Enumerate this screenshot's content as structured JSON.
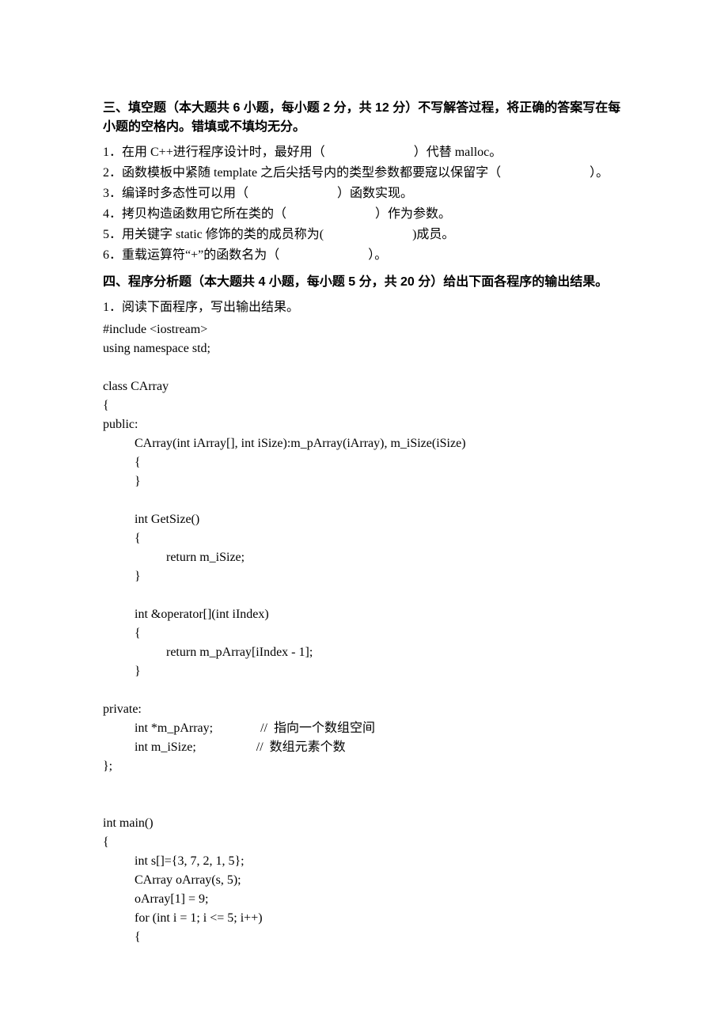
{
  "section3": {
    "title": "三、填空题（本大题共 6 小题，每小题 2 分，共 12 分）不写解答过程，将正确的答案写在每小题的空格内。错填或不填均无分。",
    "items": [
      "1．在用 C++进行程序设计时，最好用（　　　　　　　）代替 malloc。",
      "2．函数模板中紧随 template 之后尖括号内的类型参数都要寇以保留字（　　　　　　　）。",
      "3．编译时多态性可以用（　　　　　　　）函数实现。",
      "4．拷贝构造函数用它所在类的（　　　　　　　）作为参数。",
      "5．用关键字 static 修饰的类的成员称为(　　　　　　　)成员。",
      "6．重载运算符“+”的函数名为（　　　　　　　）。"
    ]
  },
  "section4": {
    "title": "四、程序分析题（本大题共 4 小题，每小题 5 分，共 20 分）给出下面各程序的输出结果。",
    "q1": {
      "prompt": "1．阅读下面程序，写出输出结果。",
      "code": [
        {
          "i": 0,
          "t": "#include <iostream>"
        },
        {
          "i": 0,
          "t": "using namespace std;"
        },
        {
          "i": 0,
          "t": ""
        },
        {
          "i": 0,
          "t": "class CArray"
        },
        {
          "i": 0,
          "t": "{"
        },
        {
          "i": 0,
          "t": "public:"
        },
        {
          "i": 1,
          "t": "CArray(int iArray[], int iSize):m_pArray(iArray), m_iSize(iSize)"
        },
        {
          "i": 1,
          "t": "{"
        },
        {
          "i": 1,
          "t": "}"
        },
        {
          "i": 0,
          "t": ""
        },
        {
          "i": 1,
          "t": "int GetSize()"
        },
        {
          "i": 1,
          "t": "{"
        },
        {
          "i": 2,
          "t": "return m_iSize;"
        },
        {
          "i": 1,
          "t": "}"
        },
        {
          "i": 0,
          "t": ""
        },
        {
          "i": 1,
          "t": "int &operator[](int iIndex)"
        },
        {
          "i": 1,
          "t": "{"
        },
        {
          "i": 2,
          "t": "return m_pArray[iIndex - 1];"
        },
        {
          "i": 1,
          "t": "}"
        },
        {
          "i": 0,
          "t": ""
        },
        {
          "i": 0,
          "t": "private:"
        },
        {
          "i": 1,
          "t": "int *m_pArray;               //  指向一个数组空间"
        },
        {
          "i": 1,
          "t": "int m_iSize;                   //  数组元素个数"
        },
        {
          "i": 0,
          "t": "};"
        },
        {
          "i": 0,
          "t": ""
        },
        {
          "i": 0,
          "t": ""
        },
        {
          "i": 0,
          "t": "int main()"
        },
        {
          "i": 0,
          "t": "{"
        },
        {
          "i": 1,
          "t": "int s[]={3, 7, 2, 1, 5};"
        },
        {
          "i": 1,
          "t": "CArray oArray(s, 5);"
        },
        {
          "i": 1,
          "t": "oArray[1] = 9;"
        },
        {
          "i": 1,
          "t": "for (int i = 1; i <= 5; i++)"
        },
        {
          "i": 1,
          "t": "{"
        }
      ]
    }
  }
}
